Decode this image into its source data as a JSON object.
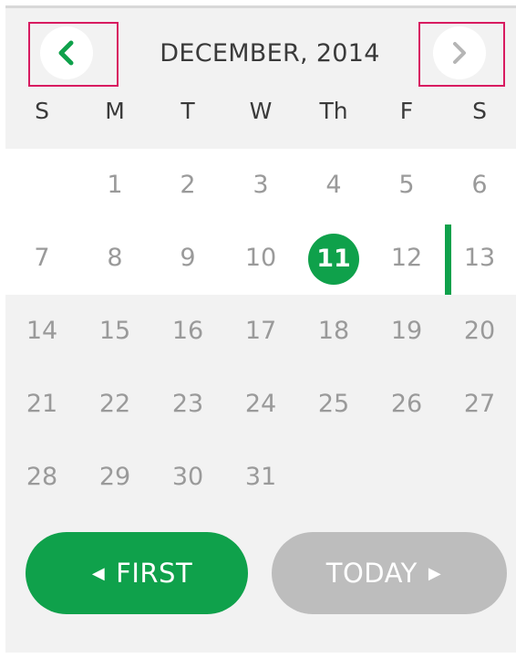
{
  "header": {
    "month_label": "DECEMBER, 2014",
    "prev_icon": "chevron-left-icon",
    "next_icon": "chevron-right-icon"
  },
  "weekdays": [
    "S",
    "M",
    "T",
    "W",
    "Th",
    "F",
    "S"
  ],
  "weeks": [
    [
      "",
      "1",
      "2",
      "3",
      "4",
      "5",
      "6"
    ],
    [
      "7",
      "8",
      "9",
      "10",
      "11",
      "12",
      "13"
    ],
    [
      "14",
      "15",
      "16",
      "17",
      "18",
      "19",
      "20"
    ],
    [
      "21",
      "22",
      "23",
      "24",
      "25",
      "26",
      "27"
    ],
    [
      "28",
      "29",
      "30",
      "31",
      "",
      "",
      ""
    ]
  ],
  "selected_day": "11",
  "buttons": {
    "first_label": "FIRST",
    "today_label": "TODAY"
  },
  "colors": {
    "accent": "#0fa14b",
    "highlight_box": "#d81b60",
    "disabled_button": "#bdbdbd"
  }
}
